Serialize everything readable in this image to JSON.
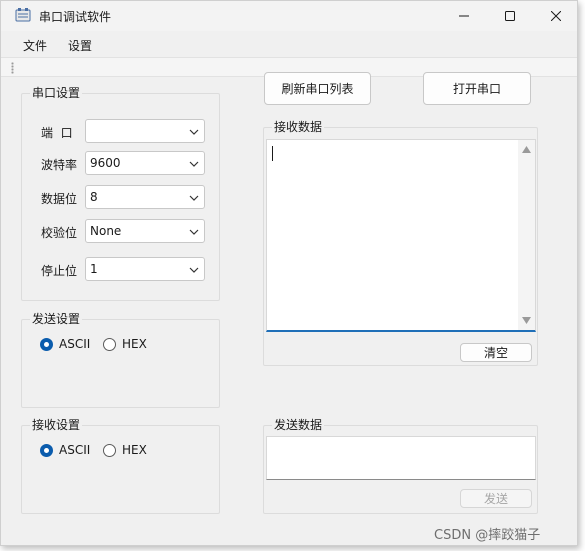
{
  "window": {
    "title": "串口调试软件",
    "icon": "app-icon",
    "controls": [
      "minimize-icon",
      "maximize-icon",
      "close-icon"
    ]
  },
  "menu": {
    "file": "文件",
    "settings": "设置"
  },
  "serial_settings": {
    "title": "串口设置",
    "port_label": "端  口",
    "port_value": "",
    "baud_label": "波特率",
    "baud_value": "9600",
    "databits_label": "数据位",
    "databits_value": "8",
    "parity_label": "校验位",
    "parity_value": "None",
    "stopbits_label": "停止位",
    "stopbits_value": "1"
  },
  "send_settings": {
    "title": "发送设置",
    "ascii_label": "ASCII",
    "hex_label": "HEX",
    "selected": "ASCII"
  },
  "receive_settings": {
    "title": "接收设置",
    "ascii_label": "ASCII",
    "hex_label": "HEX",
    "selected": "ASCII"
  },
  "buttons": {
    "refresh": "刷新串口列表",
    "open": "打开串口",
    "clear": "清空",
    "send": "发送"
  },
  "receive_area": {
    "title": "接收数据",
    "text": ""
  },
  "send_area": {
    "title": "发送数据",
    "text": ""
  },
  "watermark": "CSDN @摔跤猫子",
  "colors": {
    "accent": "#0b5cad",
    "window_bg": "#f0f0f0"
  }
}
